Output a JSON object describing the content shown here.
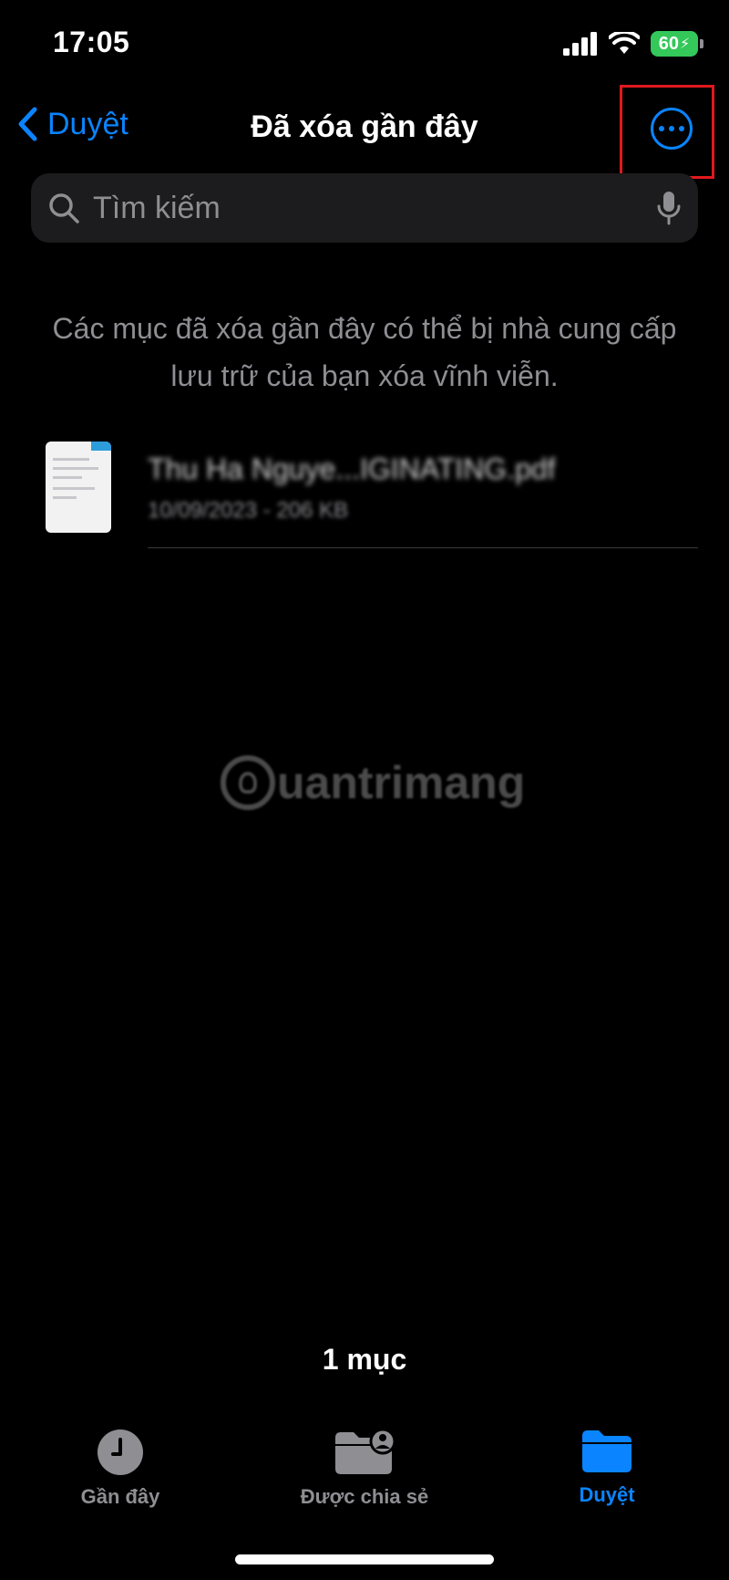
{
  "status_bar": {
    "time": "17:05",
    "battery_level": "60",
    "icons": [
      "cellular-signal-icon",
      "wifi-icon",
      "battery-charging-icon"
    ]
  },
  "nav": {
    "back_label": "Duyệt",
    "title": "Đã xóa gần đây",
    "more_icon": "ellipsis-circle-icon"
  },
  "search": {
    "placeholder": "Tìm kiếm",
    "icons": [
      "search-icon",
      "microphone-icon"
    ]
  },
  "info_text": "Các mục đã xóa gần đây có thể bị nhà cung cấp lưu trữ của bạn xóa vĩnh viễn.",
  "files": [
    {
      "name": "Thu Ha Nguye...IGINATING.pdf",
      "meta": "10/09/2023 - 206 KB"
    }
  ],
  "watermark": {
    "text": "uantrimang"
  },
  "item_count": "1 mục",
  "tab_bar": {
    "tabs": [
      {
        "label": "Gần đây",
        "icon": "clock-icon",
        "active": false
      },
      {
        "label": "Được chia sẻ",
        "icon": "shared-folder-icon",
        "active": false
      },
      {
        "label": "Duyệt",
        "icon": "folder-icon",
        "active": true
      }
    ]
  },
  "colors": {
    "background": "#000000",
    "accent": "#0a84ff",
    "secondary_text": "#8e8e93",
    "search_bg": "#1c1c1e",
    "battery": "#34c759",
    "highlight": "#e0191e"
  }
}
